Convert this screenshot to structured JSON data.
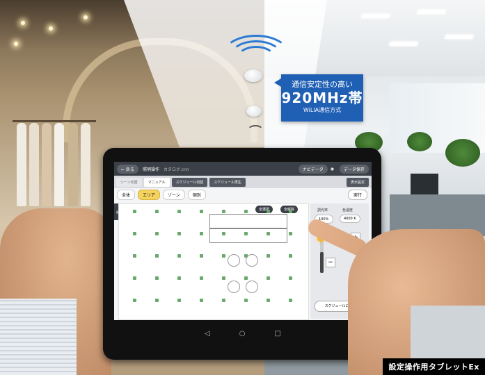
{
  "callout": {
    "line1": "通信安定性の高い",
    "line2": "920MHz帯",
    "line3": "WiLIA通信方式",
    "color": "#1f5fb4"
  },
  "tablet_ui": {
    "topbar": {
      "back_label": "← 戻る",
      "title": "照明操作",
      "filename": "カタログ.cnn",
      "navi_label": "ナビデータ",
      "save_label": "データ保存",
      "wifi_icon": "wifi-icon"
    },
    "tabs": [
      "シーン切替",
      "マニュアル",
      "スケジュール切替",
      "スケジュール再生"
    ],
    "active_tab": "マニュアル",
    "display_settings_label": "表示設定",
    "subtabs": [
      "全体",
      "エリア",
      "ゾーン",
      "個別"
    ],
    "active_subtab": "エリア",
    "execute_label": "実行",
    "all_select_label": "全選択",
    "all_clear_label": "全解除",
    "side_badge_label": "器具未配",
    "dimming_label": "調光率",
    "dimming_value": "100％",
    "color_temp_label": "色温度",
    "color_temp_value": "4000 K",
    "schedule_return_label": "スケジュールに戻る",
    "accent_color": "#f7b733"
  },
  "android_nav": {
    "back_icon": "◁",
    "home_icon": "○",
    "recent_icon": "□"
  },
  "caption": "設定操作用タブレットEx"
}
